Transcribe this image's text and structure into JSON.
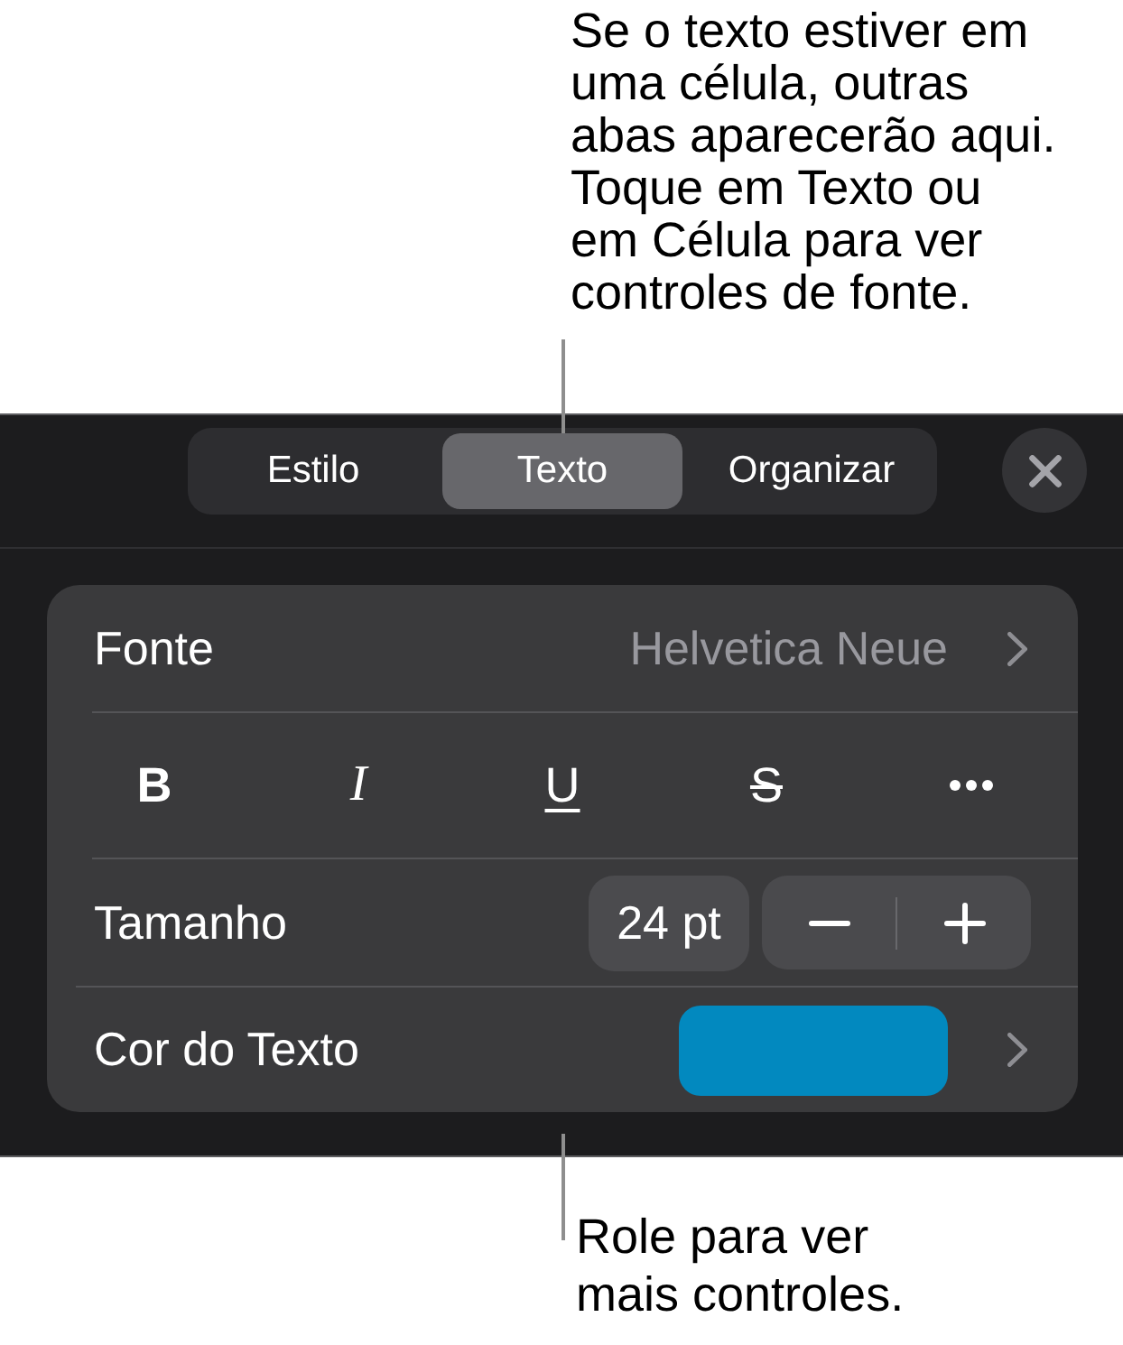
{
  "top_callout": {
    "text": "Se o texto estiver em\numa célula, outras\nabas aparecerão aqui.\nToque em Texto ou\nem Célula para ver\ncontroles de fonte."
  },
  "tabs": [
    {
      "label": "Estilo",
      "selected": false
    },
    {
      "label": "Texto",
      "selected": true
    },
    {
      "label": "Organizar",
      "selected": false
    }
  ],
  "font_row": {
    "label": "Fonte",
    "value": "Helvetica Neue"
  },
  "style_buttons": [
    {
      "kind": "bold",
      "label": "B"
    },
    {
      "kind": "italic",
      "label": "I"
    },
    {
      "kind": "underline",
      "label": "U"
    },
    {
      "kind": "strikethrough",
      "label": "S"
    },
    {
      "kind": "more"
    }
  ],
  "size_row": {
    "label": "Tamanho",
    "value": "24 pt"
  },
  "color_row": {
    "label": "Cor do Texto",
    "color": "#0289bf"
  },
  "bottom_callout": {
    "text": "Role para ver\nmais controles."
  }
}
